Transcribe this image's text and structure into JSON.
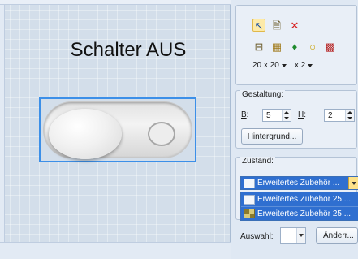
{
  "canvas": {
    "title": "Schalter AUS"
  },
  "toolbar": {
    "row1": [
      {
        "icon": "arrow-pointer-icon",
        "glyph": "↖",
        "color": "#1a4fa0"
      },
      {
        "icon": "properties-icon",
        "glyph": "🗎",
        "color": "#6b5b2a"
      },
      {
        "icon": "delete-icon",
        "glyph": "✕",
        "color": "#d62020"
      }
    ],
    "row2": [
      {
        "icon": "button-shape-icon",
        "glyph": "⊟",
        "color": "#6b5b2a"
      },
      {
        "icon": "grid-icon",
        "glyph": "▦",
        "color": "#a07a1a"
      },
      {
        "icon": "green-pin-icon",
        "glyph": "♦",
        "color": "#1e8a2e"
      },
      {
        "icon": "circle-icon",
        "glyph": "○",
        "color": "#c9a000"
      },
      {
        "icon": "checker-icon",
        "glyph": "▩",
        "color": "#b42020"
      }
    ],
    "size_label": "20 x 20",
    "scale_label": "x 2"
  },
  "gestaltung": {
    "legend": "Gestaltung:",
    "b_label_underline": "B",
    "b_label_rest": ":",
    "b_value": "5",
    "h_label_underline": "H",
    "h_label_rest": ":",
    "h_value": "2",
    "hintergrund_label": "Hintergrund..."
  },
  "zustand": {
    "legend": "Zustand:",
    "selected": "Erweitertes Zubehör ...",
    "options": [
      "Erweitertes Zubehör 25 ...",
      "Erweitertes Zubehör 25 ..."
    ]
  },
  "auswahl": {
    "label": "Auswahl:",
    "value": "",
    "aendern_label": "Änderr..."
  }
}
